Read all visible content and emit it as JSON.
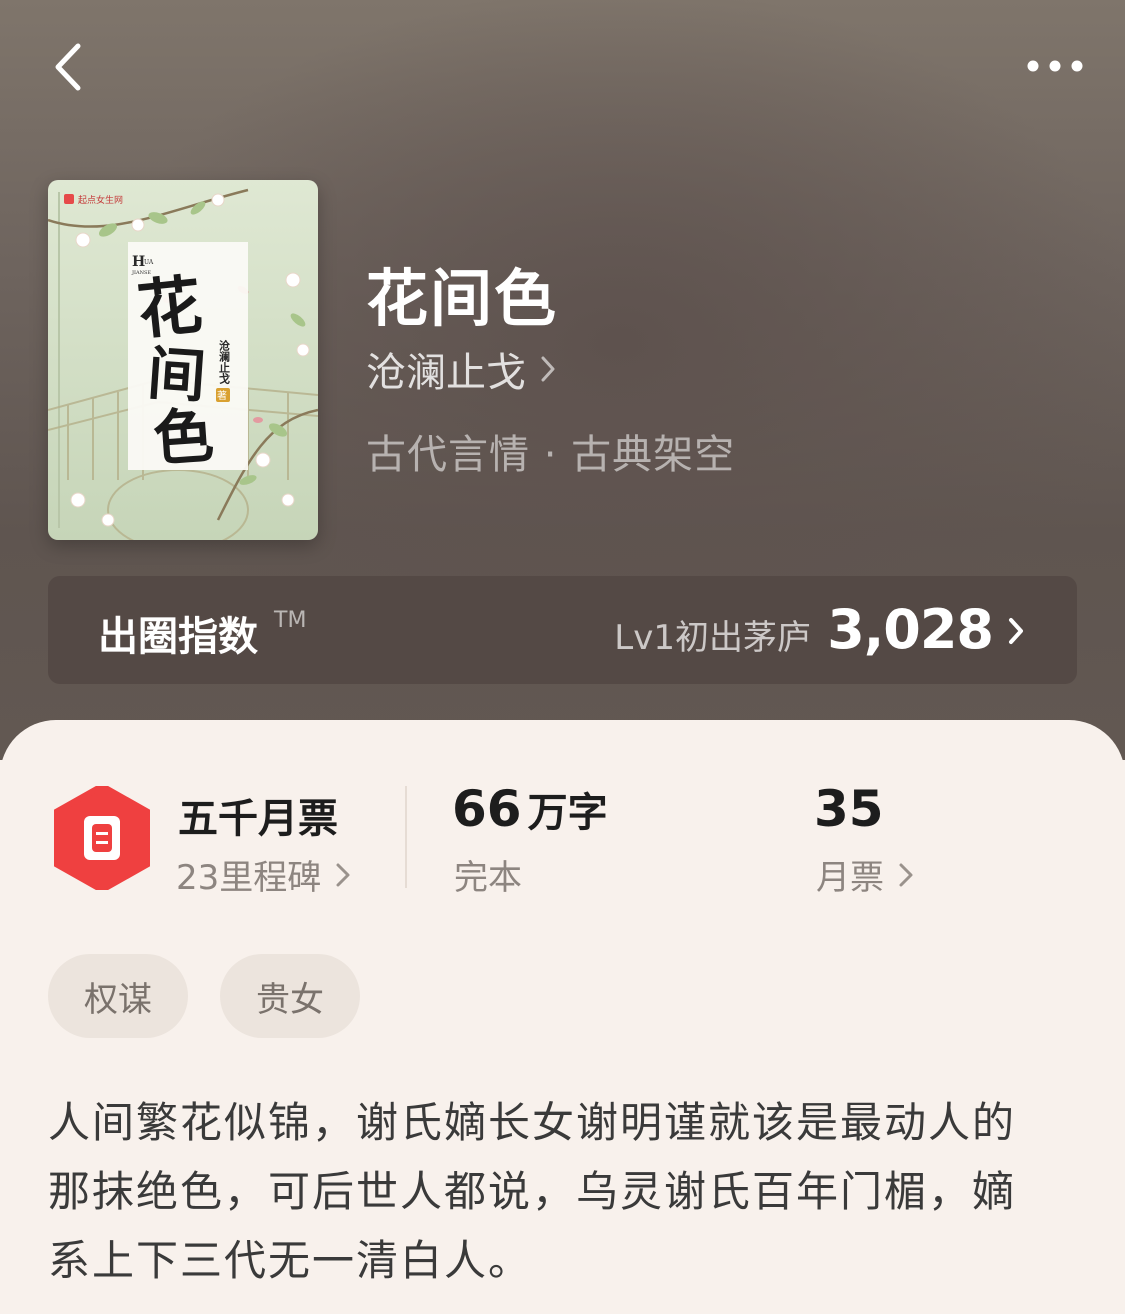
{
  "header": {
    "back_icon": "chevron-left-icon",
    "more_icon": "more-dots-icon"
  },
  "book": {
    "title": "花间色",
    "author": "沧澜止戈",
    "genre": "古代言情 · 古典架空",
    "cover": {
      "publisher_logo": "起点女生网",
      "pinyin_h": "H",
      "pinyin_rest": "UA",
      "pinyin_line2": "JIANSE",
      "calligraphy": [
        "花",
        "间",
        "色"
      ],
      "author_vertical": "沧澜止戈",
      "zhu": "著"
    }
  },
  "index": {
    "label": "出圈指数",
    "tm": "TM",
    "level": "Lv1初出茅庐",
    "score": "3,028"
  },
  "stats": {
    "badge_title": "五千月票",
    "badge_sub": "23里程碑",
    "words_num": "66",
    "words_unit": "万字",
    "status": "完本",
    "votes_num": "35",
    "votes_label": "月票"
  },
  "tags": [
    "权谋",
    "贵女"
  ],
  "description_lines": [
    "人间繁花似锦，谢氏嫡长女谢明谨就该是最动人的",
    "那抹绝色，可后世人都说，乌灵谢氏百年门楣，嫡",
    "系上下三代无一清白人。"
  ],
  "colors": {
    "hero_bg": "#6e645e",
    "index_bar_bg": "#544945",
    "sheet_bg": "#f8f1ec",
    "badge_red": "#ef4040",
    "tag_bg": "#ece4dd"
  }
}
